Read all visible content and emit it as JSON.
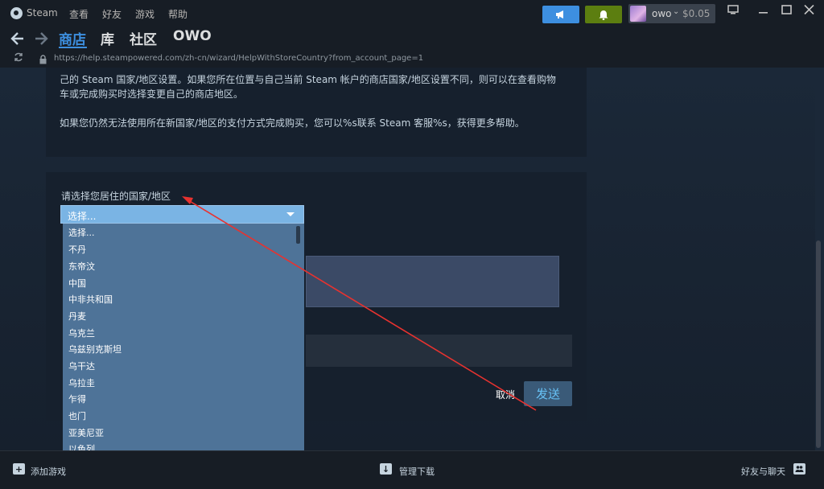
{
  "menubar": {
    "app_name": "Steam",
    "items": [
      "查看",
      "好友",
      "游戏",
      "帮助"
    ]
  },
  "account": {
    "name": "owo",
    "balance": "$0.05"
  },
  "nav": {
    "tabs": [
      "商店",
      "库",
      "社区",
      "OWO"
    ]
  },
  "url": {
    "text": "https://help.steampowered.com/zh-cn/wizard/HelpWithStoreCountry?from_account_page=1"
  },
  "panel1": {
    "line1": "己的 Steam 国家/地区设置。如果您所在位置与自己当前 Steam 帐户的商店国家/地区设置不同，则可以在查看购物",
    "line2": "车或完成购买时选择变更自己的商店地区。",
    "line3": "如果您仍然无法使用所在新国家/地区的支付方式完成购买，您可以%s联系 Steam 客服%s，获得更多帮助。"
  },
  "form": {
    "country_label": "请选择您居住的国家/地区",
    "select_value": "选择...",
    "options": [
      "选择...",
      "不丹",
      "东帝汶",
      "中国",
      "中非共和国",
      "丹麦",
      "乌克兰",
      "乌兹别克斯坦",
      "乌干达",
      "乌拉圭",
      "乍得",
      "也门",
      "亚美尼亚",
      "以色列"
    ],
    "cancel_label": "取消",
    "send_label": "发送"
  },
  "footer": {
    "add_game": "添加游戏",
    "manage_downloads": "管理下载",
    "friends_chat": "好友与聊天"
  },
  "colors": {
    "accent": "#3d8fe0",
    "annotation_arrow": "#e8322f"
  }
}
